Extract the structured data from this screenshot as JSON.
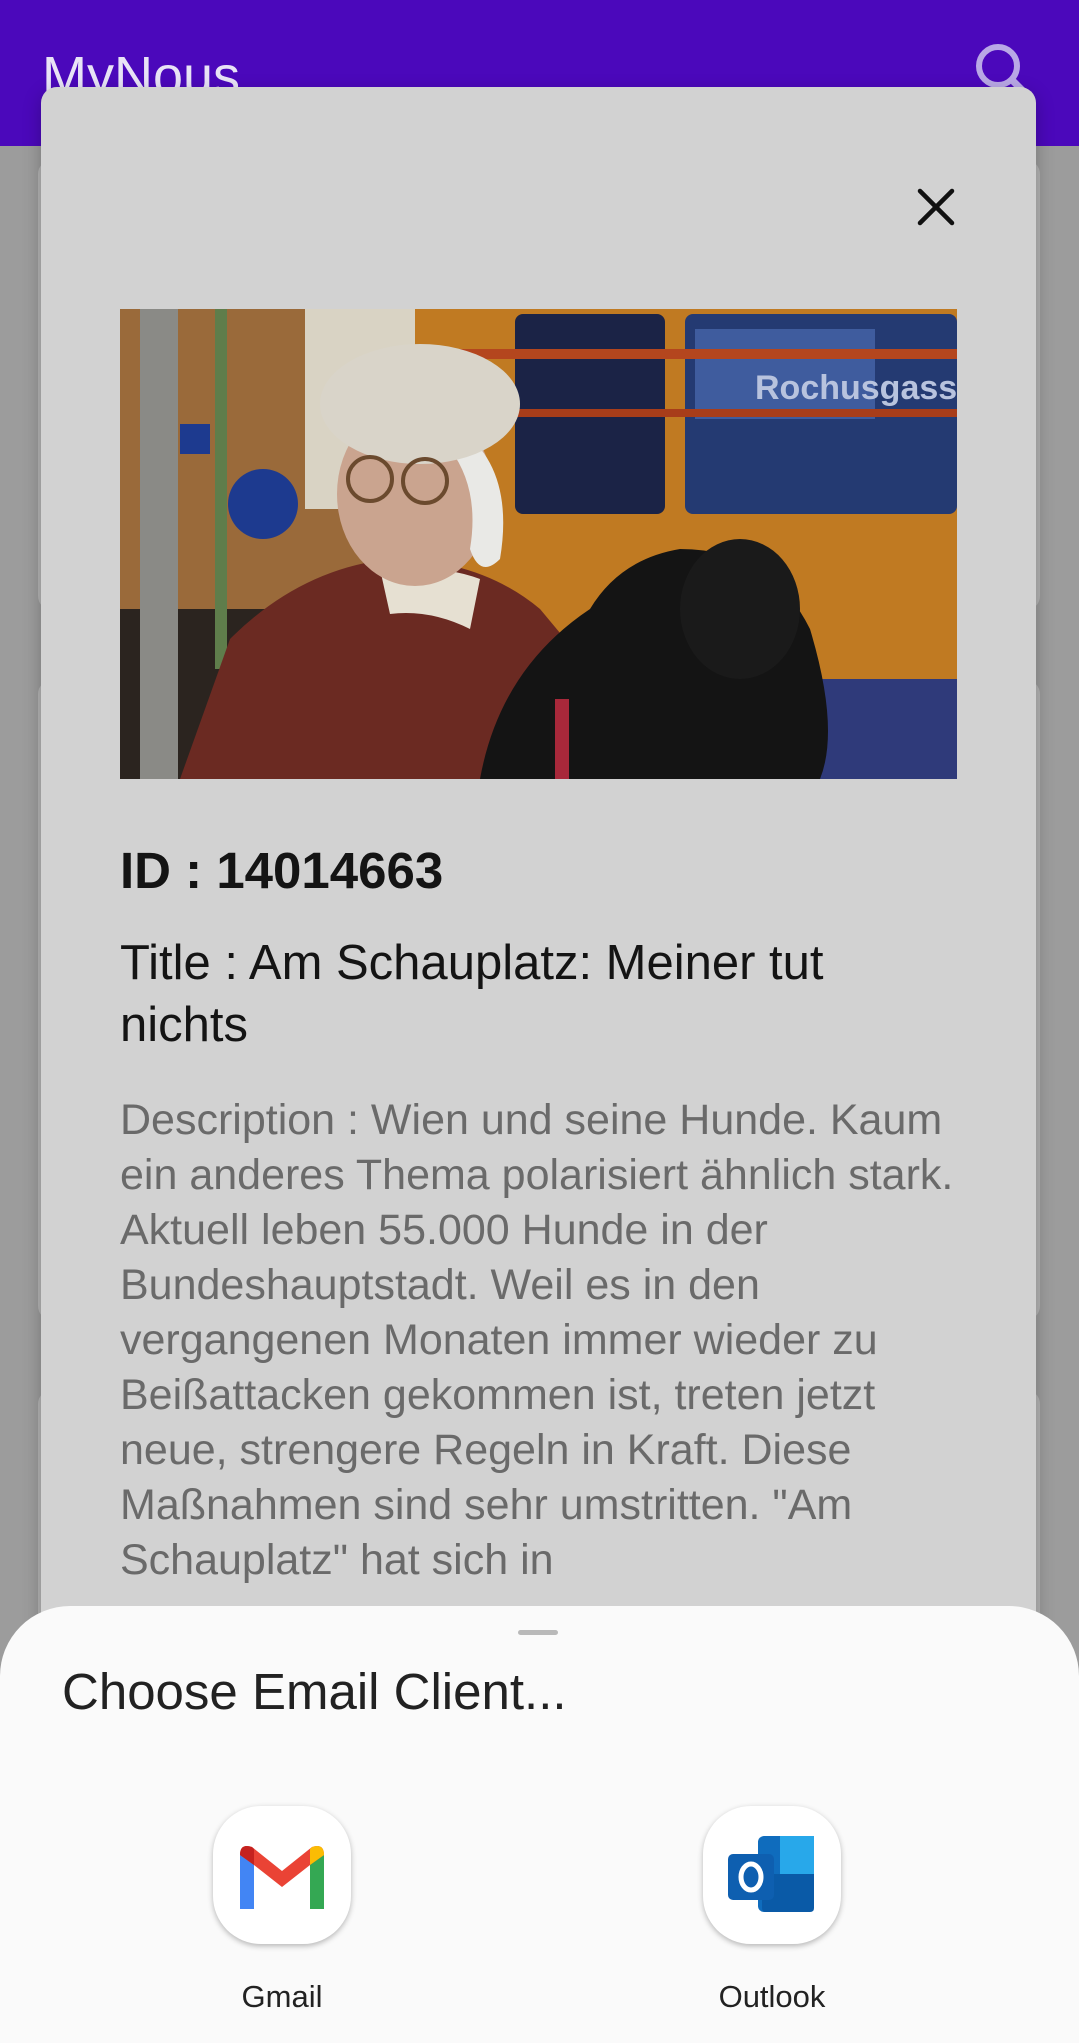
{
  "app_bar": {
    "title": "MyNous",
    "search_icon": "search-icon",
    "color": "#4b08bb"
  },
  "dialog": {
    "close_icon": "close-icon",
    "id_text": "ID : 14014663",
    "title_text": "Title : Am Schauplatz: Meiner tut nichts",
    "description_text": "Description : Wien und seine Hunde. Kaum ein anderes Thema polarisiert ähnlich stark. Aktuell leben 55.000 Hunde in der Bundeshauptstadt. Weil es in den vergangenen Monaten immer wieder zu Beißattacken gekommen ist, treten jetzt neue, strengere Regeln in Kraft. Diese Maßnahmen sind sehr umstritten. \"Am Schauplatz\" hat sich in",
    "photo_sign_text": "Rochusgass"
  },
  "sheet": {
    "title": "Choose Email Client...",
    "apps": [
      {
        "label": "Gmail",
        "icon": "gmail-icon"
      },
      {
        "label": "Outlook",
        "icon": "outlook-icon"
      }
    ]
  }
}
